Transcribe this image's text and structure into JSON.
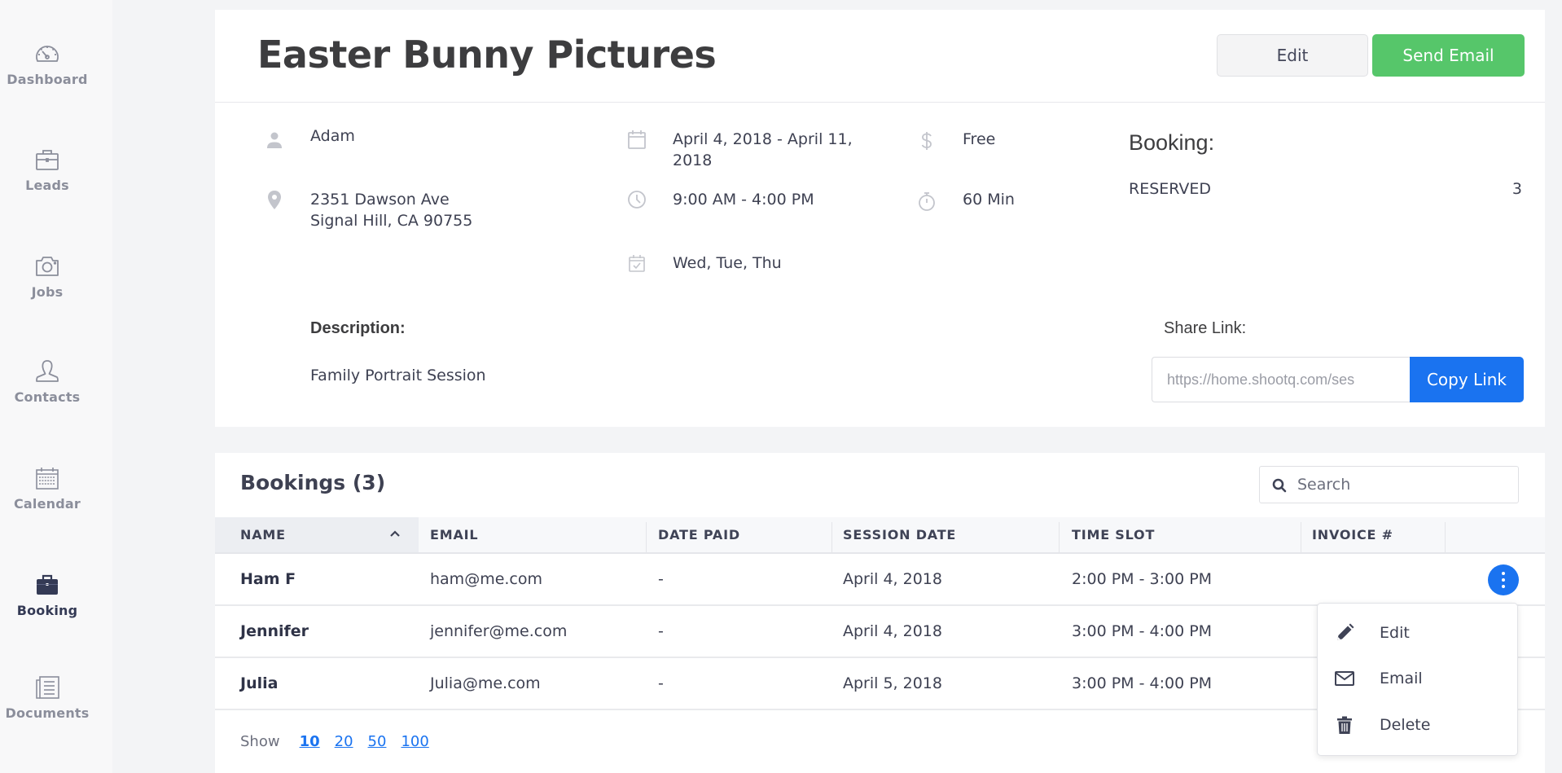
{
  "sidebar": {
    "items": [
      {
        "label": "Dashboard",
        "icon": "dashboard-gauge-icon",
        "active": false
      },
      {
        "label": "Leads",
        "icon": "briefcase-outline-icon",
        "active": false
      },
      {
        "label": "Jobs",
        "icon": "camera-icon",
        "active": false
      },
      {
        "label": "Contacts",
        "icon": "person-outline-icon",
        "active": false
      },
      {
        "label": "Calendar",
        "icon": "calendar-grid-icon",
        "active": false
      },
      {
        "label": "Booking",
        "icon": "briefcase-filled-icon",
        "active": true
      },
      {
        "label": "Documents",
        "icon": "documents-icon",
        "active": false
      }
    ]
  },
  "header": {
    "title": "Easter Bunny Pictures",
    "edit_label": "Edit",
    "send_email_label": "Send Email"
  },
  "details": {
    "contact_name": "Adam",
    "address_line1": "2351 Dawson Ave",
    "address_line2": "Signal Hill, CA 90755",
    "date_range_line1": "April 4, 2018 - April 11,",
    "date_range_line2": "2018",
    "time_range": "9:00 AM - 4:00 PM",
    "weekdays": "Wed, Tue, Thu",
    "price": "Free",
    "duration": "60 Min",
    "booking_heading": "Booking:",
    "booking_status": "RESERVED",
    "booking_count": "3",
    "description_label": "Description:",
    "description": "Family Portrait Session",
    "share_label": "Share Link:",
    "share_url": "https://home.shootq.com/ses",
    "copy_link_label": "Copy Link"
  },
  "bookings": {
    "title": "Bookings (3)",
    "search_placeholder": "Search",
    "columns": [
      "NAME",
      "EMAIL",
      "DATE PAID",
      "SESSION DATE",
      "TIME SLOT",
      "INVOICE #"
    ],
    "sorted_column": "NAME",
    "sort_direction": "ascending",
    "rows": [
      {
        "name": "Ham F",
        "email": "ham@me.com",
        "date_paid": "-",
        "session_date": "April 4, 2018",
        "time_slot": "2:00 PM - 3:00 PM",
        "invoice": ""
      },
      {
        "name": "Jennifer",
        "email": "jennifer@me.com",
        "date_paid": "-",
        "session_date": "April 4, 2018",
        "time_slot": "3:00 PM - 4:00 PM",
        "invoice": ""
      },
      {
        "name": "Julia",
        "email": "Julia@me.com",
        "date_paid": "-",
        "session_date": "April 5, 2018",
        "time_slot": "3:00 PM - 4:00 PM",
        "invoice": ""
      }
    ],
    "row_menu": [
      {
        "label": "Edit",
        "icon": "pencil-icon"
      },
      {
        "label": "Email",
        "icon": "envelope-icon"
      },
      {
        "label": "Delete",
        "icon": "trash-icon"
      }
    ],
    "show_label": "Show",
    "page_sizes": [
      "10",
      "20",
      "50",
      "100"
    ],
    "current_page_size": "10"
  },
  "colors": {
    "primary": "#1a73f0",
    "success": "#56c66a",
    "text": "#3e4152",
    "sidebar_active": "#343a55",
    "sidebar_inactive": "#8b8e9b"
  }
}
